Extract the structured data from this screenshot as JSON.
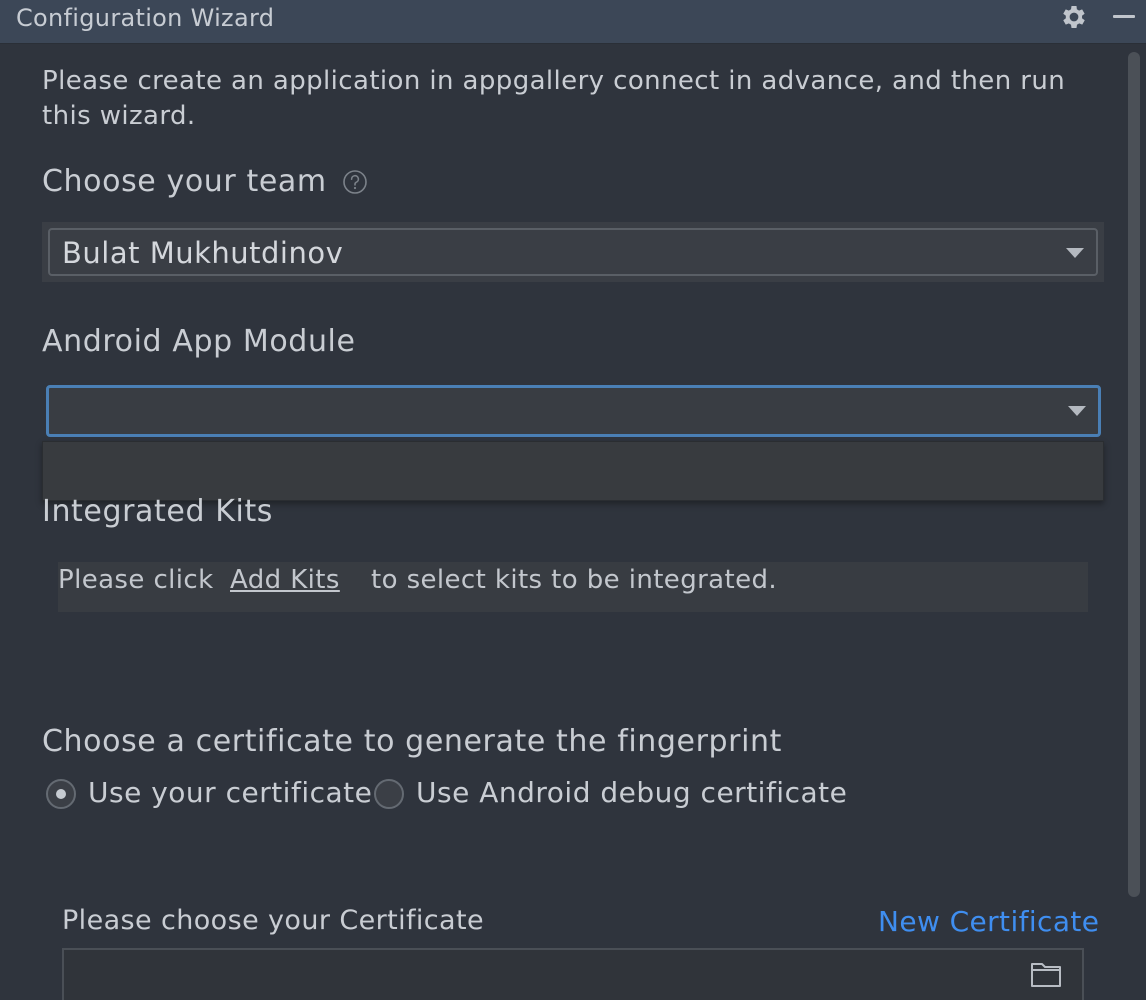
{
  "window": {
    "title": "Configuration Wizard"
  },
  "intro_text": "Please create an application in appgallery connect in advance, and then run this wizard.",
  "team": {
    "label": "Choose your team",
    "selected": "Bulat Mukhutdinov"
  },
  "module": {
    "label": "Android App Module",
    "selected": ""
  },
  "kits": {
    "label": "Integrated Kits",
    "text_before": "Please click",
    "link": "Add Kits",
    "text_after": "to select kits to be integrated."
  },
  "certificate": {
    "label": "Choose a certificate to generate the fingerprint",
    "options": [
      {
        "label": "Use your certificate",
        "checked": true
      },
      {
        "label": "Use Android debug certificate",
        "checked": false
      }
    ],
    "choose_label": "Please choose your Certificate",
    "new_link": "New Certificate",
    "path_value": ""
  },
  "icons": {
    "settings": "gear-icon",
    "minimize": "minimize-icon",
    "help": "question-circle-icon",
    "dropdown": "chevron-down-icon",
    "browse": "folder-icon"
  },
  "colors": {
    "background": "#2f343d",
    "titlebar": "#3c4757",
    "link": "#3f8ef0",
    "focus": "#4a7fb5"
  }
}
